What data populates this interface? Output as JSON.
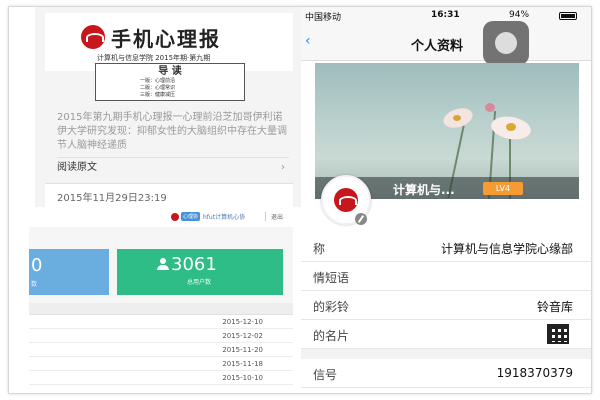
{
  "article": {
    "title": "手机心理报",
    "subtitle": "计算机与信息学院 2015年期·第九期",
    "toc_title": "导 读",
    "toc_items": [
      "一版：心理前沿",
      "二版：心理常识",
      "三版：健康减压"
    ],
    "summary": "2015年第九期手机心理报一心理前沿芝加哥伊利诺伊大学研究发现：抑郁女性的大脑组织中存在大量调节人脑神经递质",
    "read_more": "阅读原文",
    "date": "2015年11月29日23:19"
  },
  "admin": {
    "badge": "心理协",
    "user": "hfut计算机心协",
    "logout": "退出",
    "stat_left_value": "0",
    "stat_left_label": "数",
    "stat_right_value": "3061",
    "stat_right_label": "总用户数",
    "dates": [
      "2015-12-10",
      "2015-12-02",
      "2015-11-20",
      "2015-11-18",
      "2015-10-10"
    ]
  },
  "phone": {
    "carrier": "中国移动",
    "time": "16:31",
    "battery": "94%",
    "nav_title": "个人资料",
    "cover_name": "计算机与...",
    "level": "LV4",
    "fields": [
      {
        "label": "称",
        "value": "计算机与信息学院心缘部"
      },
      {
        "label": "情短语",
        "value": ""
      },
      {
        "label": "的彩铃",
        "value": "铃音库"
      },
      {
        "label": "的名片",
        "value": ""
      },
      {
        "label": "信号",
        "value": "1918370379"
      }
    ]
  }
}
